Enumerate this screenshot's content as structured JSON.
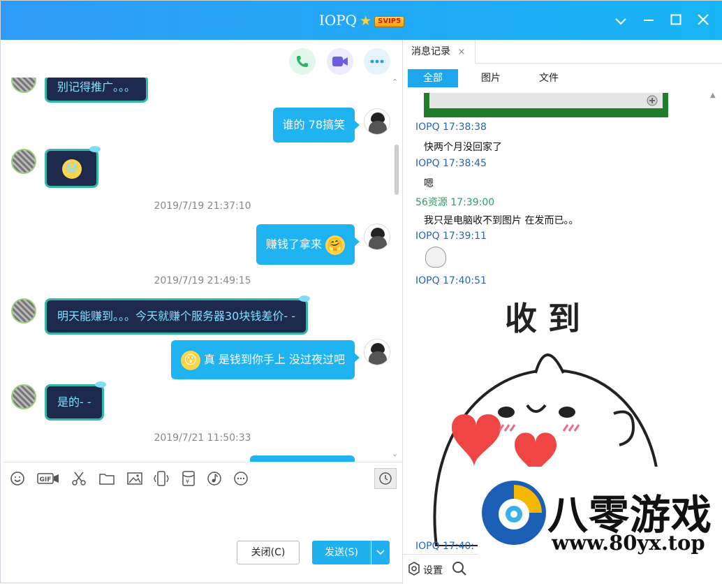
{
  "window": {
    "title": "IOPQ",
    "vip_badge": "SVIP5",
    "star": "★",
    "accent": "#1fb3f2"
  },
  "chat": {
    "messages": [
      {
        "side": "left",
        "text": "别记得推广。。。"
      },
      {
        "side": "right",
        "text": "谁的 78搞笑"
      },
      {
        "side": "left",
        "emoji": "😂"
      },
      {
        "timestamp": "2019/7/19 21:37:10"
      },
      {
        "side": "right",
        "text": "赚钱了拿来",
        "emoji": "🤗"
      },
      {
        "timestamp": "2019/7/19 21:49:15"
      },
      {
        "side": "left",
        "text": "明天能赚到。。。今天就赚个服务器30块钱差价- -"
      },
      {
        "side": "right",
        "emoji": "😗",
        "text": "真 是钱到你手上  没过夜过吧"
      },
      {
        "side": "left",
        "text": "是的- -"
      },
      {
        "timestamp": "2019/7/21 11:50:33"
      }
    ]
  },
  "toolbar": {
    "icons": [
      "emoji-icon",
      "gif-icon",
      "scissors-icon",
      "folder-icon",
      "image-icon",
      "shake-icon",
      "red-packet-icon",
      "music-icon",
      "more-icon",
      "history-clock-icon"
    ],
    "close_label": "关闭(C)",
    "send_label": "发送(S)"
  },
  "history": {
    "tab_label": "消息记录",
    "filters": [
      "全部",
      "图片",
      "文件"
    ],
    "entries": [
      {
        "name": "IOPQ 17:38:38",
        "text": "快两个月没回家了"
      },
      {
        "name": "IOPQ 17:38:45",
        "text": "嗯"
      },
      {
        "name": "56资源 17:39:00",
        "text": "我只是电脑收不到图片 在发而已。。"
      },
      {
        "name": "IOPQ 17:39:11"
      },
      {
        "name": "IOPQ 17:40:51"
      },
      {
        "name": "IOPQ 17:40:"
      }
    ],
    "sticker_text": "收 到",
    "settings_label": "设置"
  },
  "watermark": {
    "name": "八零游戏",
    "url": "www.80yx.top"
  }
}
